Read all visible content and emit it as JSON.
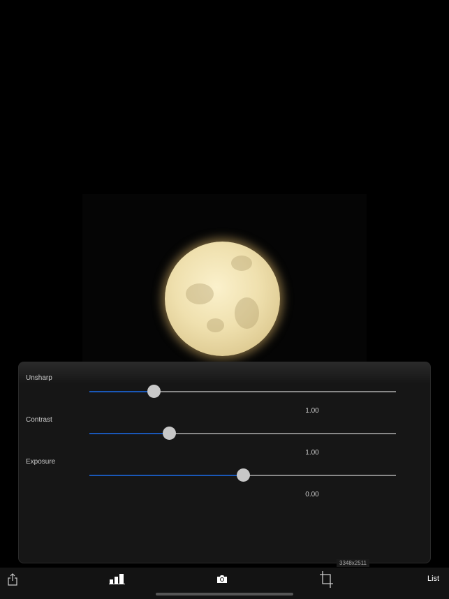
{
  "image": {
    "dimensions": "3348x2511"
  },
  "adjustments": [
    {
      "label": "Unsharp",
      "value": "1.00",
      "position": 0.21
    },
    {
      "label": "Contrast",
      "value": "1.00",
      "position": 0.26
    },
    {
      "label": "Exposure",
      "value": "0.00",
      "position": 0.5
    }
  ],
  "toolbar": {
    "list_label": "List"
  },
  "colors": {
    "accent": "#1a58b8",
    "panel": "#161616"
  }
}
